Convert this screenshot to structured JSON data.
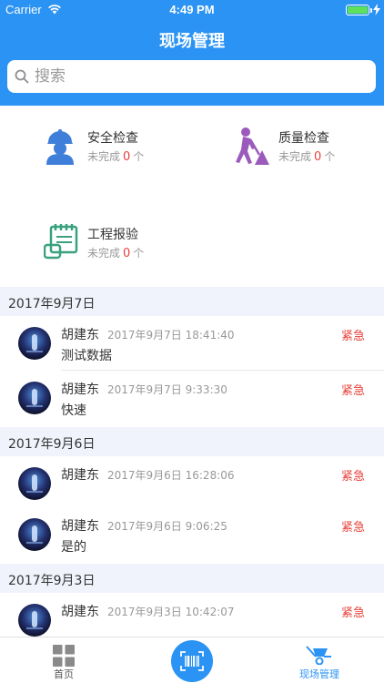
{
  "status": {
    "carrier": "Carrier",
    "time": "4:49 PM"
  },
  "nav": {
    "title": "现场管理"
  },
  "search": {
    "placeholder": "搜索"
  },
  "modules": [
    {
      "title": "安全检查",
      "status": "未完成",
      "count": "0",
      "unit": "个",
      "icon": "safety-helmet-icon",
      "color": "#3f7fd9"
    },
    {
      "title": "质量检查",
      "status": "未完成",
      "count": "0",
      "unit": "个",
      "icon": "construction-worker-icon",
      "color": "#9b5bbd"
    },
    {
      "title": "工程报验",
      "status": "未完成",
      "count": "0",
      "unit": "个",
      "icon": "clipboard-icon",
      "color": "#3aa17e"
    }
  ],
  "sections": [
    {
      "date": "2017年9月7日",
      "items": [
        {
          "name": "胡建东",
          "time": "2017年9月7日 18:41:40",
          "tag": "紧急",
          "message": "测试数据"
        },
        {
          "name": "胡建东",
          "time": "2017年9月7日 9:33:30",
          "tag": "紧急",
          "message": "快速"
        }
      ]
    },
    {
      "date": "2017年9月6日",
      "items": [
        {
          "name": "胡建东",
          "time": "2017年9月6日 16:28:06",
          "tag": "紧急",
          "message": ""
        },
        {
          "name": "胡建东",
          "time": "2017年9月6日 9:06:25",
          "tag": "紧急",
          "message": "是的"
        }
      ]
    },
    {
      "date": "2017年9月3日",
      "items": [
        {
          "name": "胡建东",
          "time": "2017年9月3日 10:42:07",
          "tag": "紧急",
          "message": ""
        }
      ]
    }
  ],
  "tabs": [
    {
      "label": "首页",
      "icon": "grid-icon",
      "active": false
    },
    {
      "label": "",
      "icon": "barcode-scan-icon",
      "active": false
    },
    {
      "label": "现场管理",
      "icon": "wheelbarrow-icon",
      "active": true
    }
  ],
  "colors": {
    "primary": "#2a93f3",
    "accent_red": "#e8413a",
    "section_bg": "#f0f3fb"
  }
}
